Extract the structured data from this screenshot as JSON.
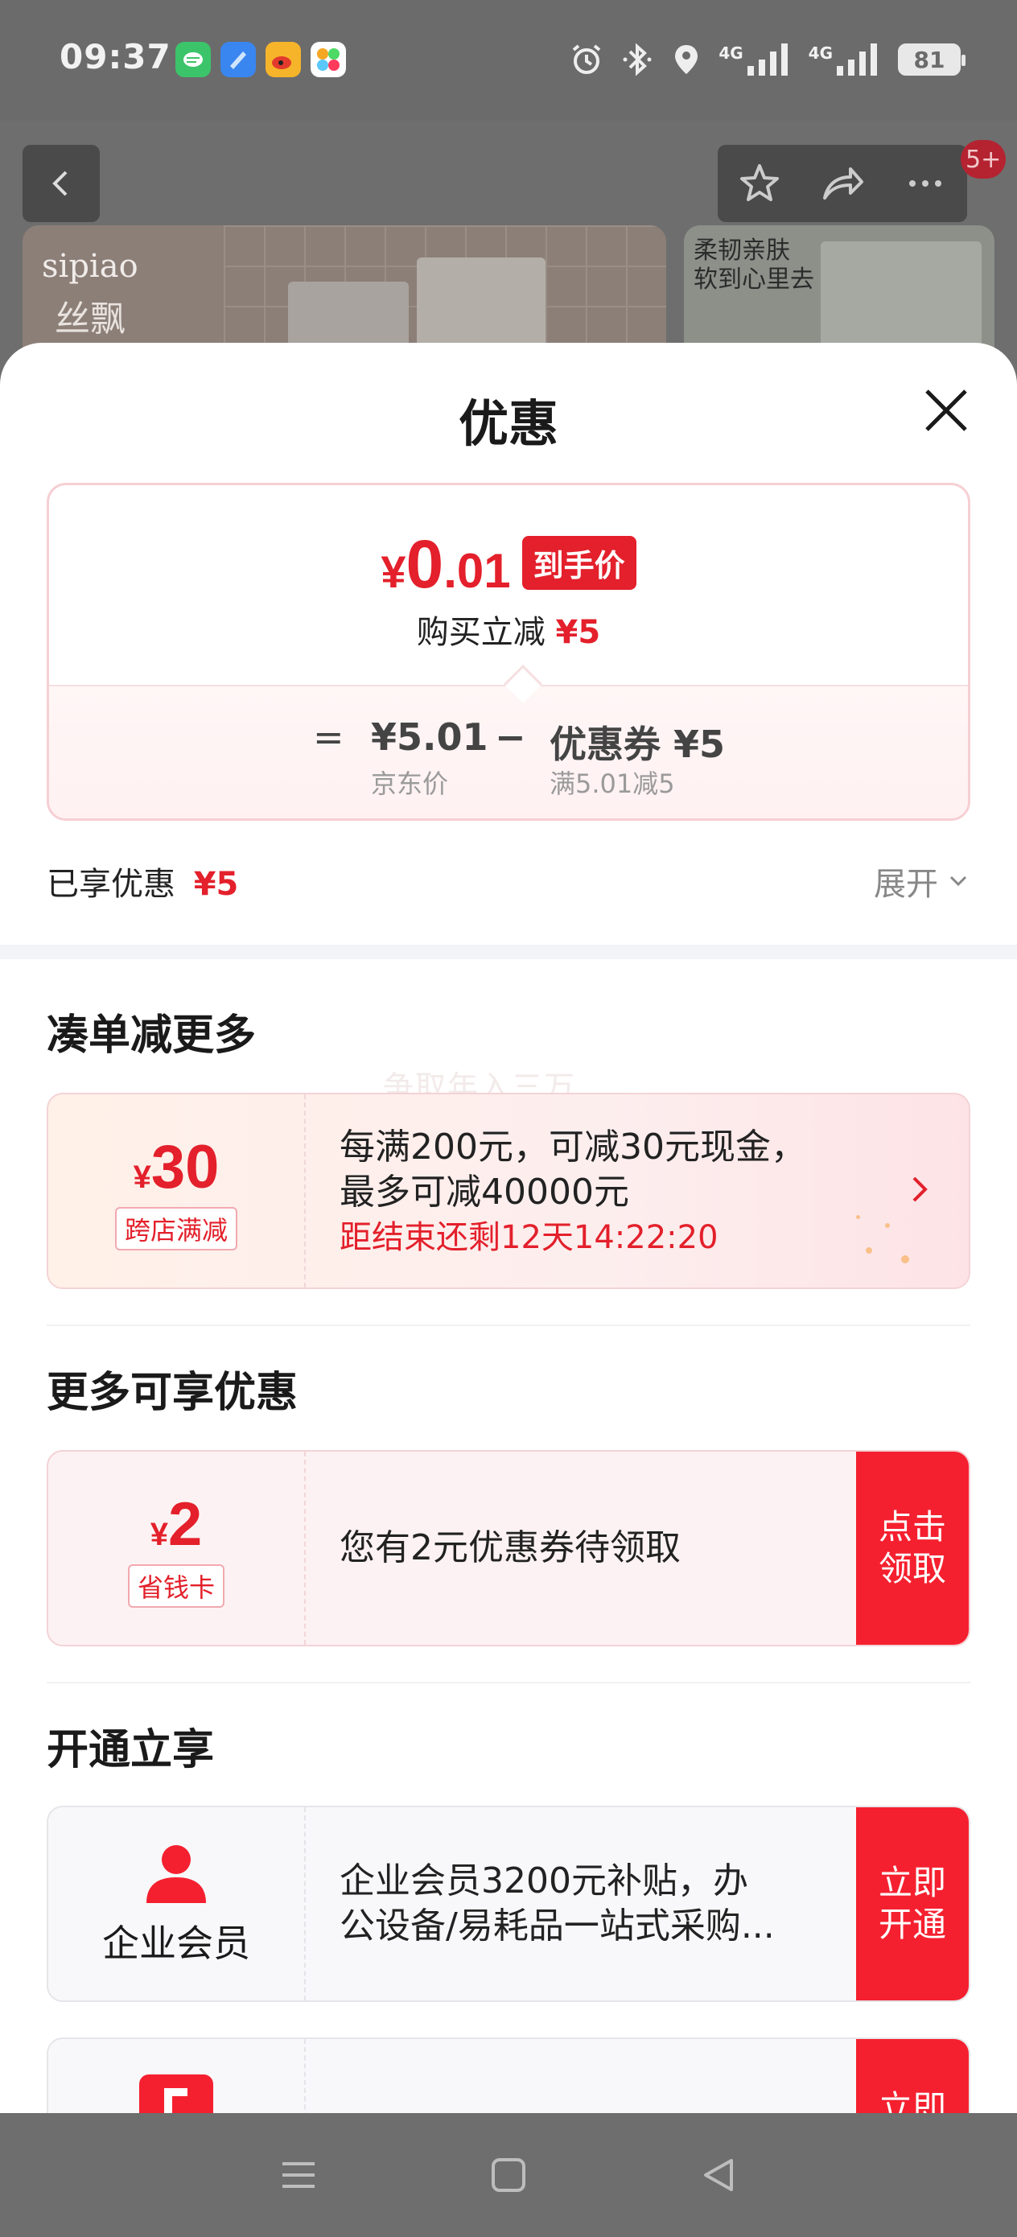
{
  "status_bar": {
    "time": "09:37",
    "apps": [
      "wechat-icon",
      "browser-icon",
      "weibo-icon",
      "photos-icon"
    ],
    "signal1": "4G",
    "signal2": "4G",
    "battery": "81"
  },
  "background_page": {
    "badge": "5+",
    "brand": "sipiao",
    "brand_cn": "丝飘",
    "right_banner_line1": "柔韧亲肤",
    "right_banner_line2": "软到心里去"
  },
  "sheet": {
    "title": "优惠",
    "price_card": {
      "currency": "¥",
      "price_int": "0",
      "price_dec": ".01",
      "price_tag": "到手价",
      "instant_label": "购买立减",
      "instant_value": "¥5",
      "equals": "=",
      "jd_price": "¥5.01",
      "jd_price_label": "京东价",
      "minus": "−",
      "coupon_value": "优惠券 ¥5",
      "coupon_condition": "满5.01减5"
    },
    "enjoyed_label": "已享优惠",
    "enjoyed_value": "¥5",
    "expand_label": "展开"
  },
  "sections": {
    "combine": {
      "title": "凑单减更多",
      "watermark": "争取年入三万",
      "coupon": {
        "currency": "¥",
        "amount": "30",
        "label": "跨店满减",
        "line1": "每满200元，可减30元现金，",
        "line2": "最多可减40000元",
        "timer": "距结束还剩12天14:22:20"
      }
    },
    "more": {
      "title": "更多可享优惠",
      "coupon": {
        "currency": "¥",
        "amount": "2",
        "label": "省钱卡",
        "text": "您有2元优惠券待领取",
        "button": "点击\n领取"
      }
    },
    "membership": {
      "title": "开通立享",
      "card": {
        "label": "企业会员",
        "line1": "企业会员3200元补贴，办",
        "line2": "公设备/易耗品一站式采购...",
        "button": "立即\n开通"
      },
      "next_button_peek": "立即"
    }
  },
  "colors": {
    "accent_red": "#e3202b",
    "button_red": "#f5202f"
  }
}
